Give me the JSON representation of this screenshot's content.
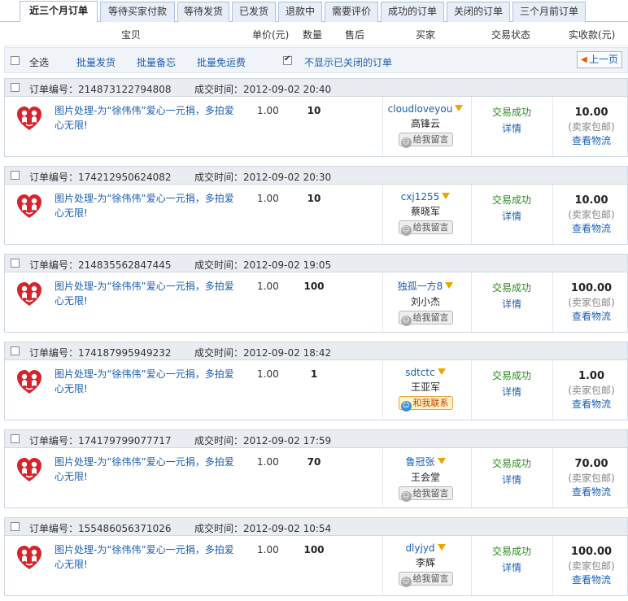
{
  "tabs": [
    "近三个月订单",
    "等待买家付款",
    "等待发货",
    "已发货",
    "退款中",
    "需要评价",
    "成功的订单",
    "关闭的订单",
    "三个月前订单"
  ],
  "header": {
    "item": "宝贝",
    "price": "单价(元)",
    "qty": "数量",
    "aftersale": "售后",
    "buyer": "买家",
    "status": "交易状态",
    "paid": "实收款(元)"
  },
  "toolbar": {
    "select_all": "全选",
    "batch_ship": "批量发货",
    "batch_memo": "批量备忘",
    "batch_free_ship": "批量免运费",
    "hide_closed": "不显示已关闭的订单",
    "prev_page": "上一页"
  },
  "order_no_label": "订单编号：",
  "time_label": "成交时间：",
  "orders": [
    {
      "no": "214873122794808",
      "time": "2012-09-02 20:40",
      "title": "图片处理-为“徐伟伟”爱心一元捐，多拍爱心无限!",
      "price": "1.00",
      "qty": "10",
      "nick": "cloudloveyou",
      "name": "高锋云",
      "msg": "给我留言",
      "online": false,
      "status": "交易成功",
      "detail": "详情",
      "amount": "10.00",
      "freeship": "(卖家包邮)",
      "logistics": "查看物流"
    },
    {
      "no": "174212950624082",
      "time": "2012-09-02 20:30",
      "title": "图片处理-为“徐伟伟”爱心一元捐，多拍爱心无限!",
      "price": "1.00",
      "qty": "10",
      "nick": "cxj1255",
      "name": "蔡晓军",
      "msg": "给我留言",
      "online": false,
      "status": "交易成功",
      "detail": "详情",
      "amount": "10.00",
      "freeship": "(卖家包邮)",
      "logistics": "查看物流"
    },
    {
      "no": "214835562847445",
      "time": "2012-09-02 19:05",
      "title": "图片处理-为“徐伟伟”爱心一元捐，多拍爱心无限!",
      "price": "1.00",
      "qty": "100",
      "nick": "独孤一方8",
      "name": "刘小杰",
      "msg": "给我留言",
      "online": false,
      "status": "交易成功",
      "detail": "详情",
      "amount": "100.00",
      "freeship": "(卖家包邮)",
      "logistics": "查看物流"
    },
    {
      "no": "174187995949232",
      "time": "2012-09-02 18:42",
      "title": "图片处理-为“徐伟伟”爱心一元捐，多拍爱心无限!",
      "price": "1.00",
      "qty": "1",
      "nick": "sdtctc",
      "name": "王亚军",
      "msg": "和我联系",
      "online": true,
      "status": "交易成功",
      "detail": "详情",
      "amount": "1.00",
      "freeship": "(卖家包邮)",
      "logistics": "查看物流"
    },
    {
      "no": "174179799077717",
      "time": "2012-09-02 17:59",
      "title": "图片处理-为“徐伟伟”爱心一元捐，多拍爱心无限!",
      "price": "1.00",
      "qty": "70",
      "nick": "鲁冠张",
      "name": "王会堂",
      "msg": "给我留言",
      "online": false,
      "status": "交易成功",
      "detail": "详情",
      "amount": "70.00",
      "freeship": "(卖家包邮)",
      "logistics": "查看物流"
    },
    {
      "no": "155486056371026",
      "time": "2012-09-02 10:54",
      "title": "图片处理-为“徐伟伟”爱心一元捐，多拍爱心无限!",
      "price": "1.00",
      "qty": "100",
      "nick": "dlyjyd",
      "name": "李辉",
      "msg": "给我留言",
      "online": false,
      "status": "交易成功",
      "detail": "详情",
      "amount": "100.00",
      "freeship": "(卖家包邮)",
      "logistics": "查看物流"
    }
  ],
  "colors": {
    "link": "#1a5fb4",
    "success": "#2b8a1e",
    "tab_bg": "#e8eef7",
    "filter_icon": "#e8a800"
  }
}
